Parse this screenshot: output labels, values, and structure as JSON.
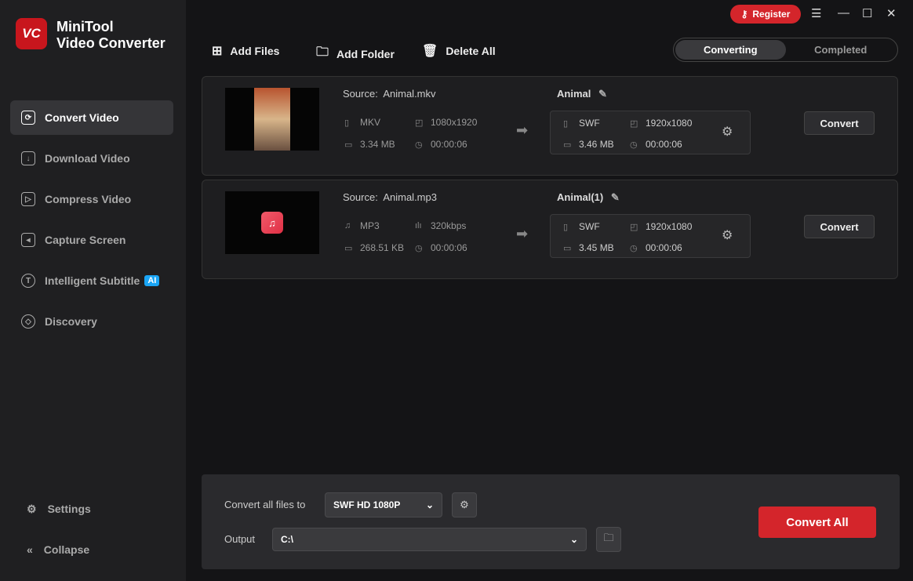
{
  "app": {
    "logo_text": "VC",
    "name_line1": "MiniTool",
    "name_line2": "Video Converter"
  },
  "sidebar": {
    "items": [
      {
        "label": "Convert Video",
        "icon": "convert-icon"
      },
      {
        "label": "Download Video",
        "icon": "download-icon"
      },
      {
        "label": "Compress Video",
        "icon": "compress-icon"
      },
      {
        "label": "Capture Screen",
        "icon": "camera-icon"
      },
      {
        "label": "Intelligent Subtitle",
        "icon": "subtitle-icon",
        "badge": "AI"
      },
      {
        "label": "Discovery",
        "icon": "compass-icon"
      }
    ],
    "settings": "Settings",
    "collapse": "Collapse"
  },
  "titlebar": {
    "register": "Register"
  },
  "toolbar": {
    "add_files": "Add Files",
    "add_folder": "Add Folder",
    "delete_all": "Delete All"
  },
  "tabs": {
    "converting": "Converting",
    "completed": "Completed"
  },
  "files": [
    {
      "source_label": "Source:",
      "source": "Animal.mkv",
      "format": "MKV",
      "resolution": "1080x1920",
      "size": "3.34 MB",
      "duration": "00:00:06",
      "output_name": "Animal",
      "out_format": "SWF",
      "out_resolution": "1920x1080",
      "out_size": "3.46 MB",
      "out_duration": "00:00:06",
      "convert": "Convert"
    },
    {
      "source_label": "Source:",
      "source": "Animal.mp3",
      "format": "MP3",
      "resolution": "320kbps",
      "size": "268.51 KB",
      "duration": "00:00:06",
      "output_name": "Animal(1)",
      "out_format": "SWF",
      "out_resolution": "1920x1080",
      "out_size": "3.45 MB",
      "out_duration": "00:00:06",
      "convert": "Convert"
    }
  ],
  "bottom": {
    "convert_all_label": "Convert all files to",
    "format": "SWF HD 1080P",
    "output_label": "Output",
    "output_path": "C:\\",
    "convert_all": "Convert All"
  },
  "colors": {
    "accent": "#d4252b",
    "ai_badge": "#1aa5f5"
  }
}
